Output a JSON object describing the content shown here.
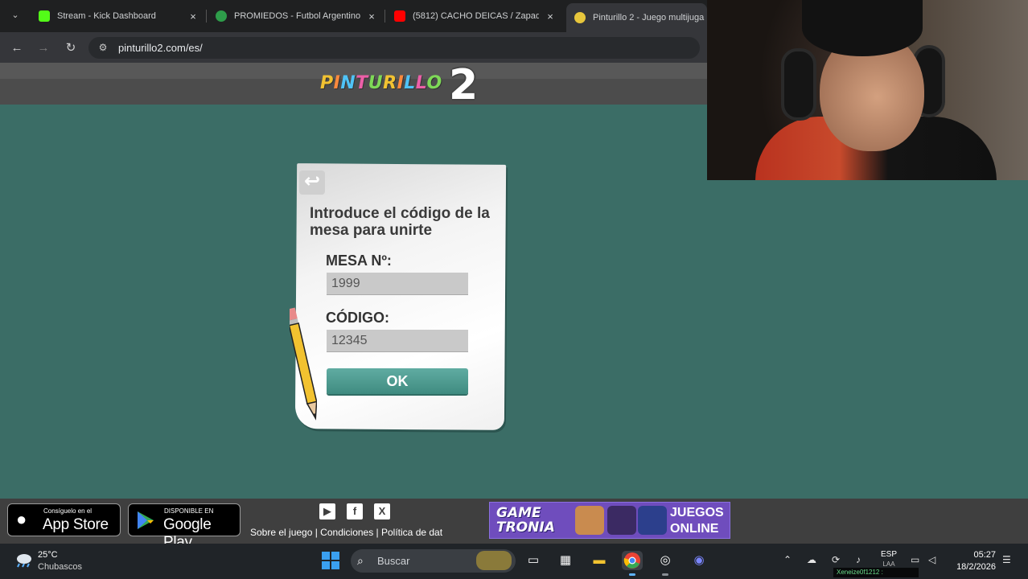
{
  "browser": {
    "tabs": [
      {
        "title": "Stream - Kick Dashboard",
        "icon": "kick-icon",
        "color": "#53fc18"
      },
      {
        "title": "PROMIEDOS - Futbol Argentino",
        "icon": "promiedos-icon",
        "color": "#2e9d4a"
      },
      {
        "title": "(5812) CACHO DEICAS / Zapad",
        "icon": "youtube-icon",
        "color": "#ff0000"
      },
      {
        "title": "Pinturillo 2 - Juego multijuga",
        "icon": "pinturillo-icon",
        "color": "#e7c63c"
      }
    ],
    "tab_close": "×",
    "address": "pinturillo2.com/es/"
  },
  "site": {
    "logo_text": "PINTURILLO",
    "logo_number": "2",
    "logo_colors": [
      "#f1c232",
      "#ff8a3d",
      "#4fc3f7",
      "#ec5fa8",
      "#7ed957"
    ]
  },
  "dialog": {
    "back_glyph": "↩",
    "title": "Introduce el código de la mesa para unirte",
    "table_label": "MESA Nº:",
    "table_value": "1999",
    "code_label": "CÓDIGO:",
    "code_value": "12345",
    "ok_label": "OK"
  },
  "footer": {
    "app_store": {
      "small": "Consíguelo en el",
      "big": "App Store"
    },
    "google_play": {
      "small": "DISPONIBLE EN",
      "big": "Google Play"
    },
    "social": [
      "youtube-icon",
      "facebook-icon",
      "x-icon"
    ],
    "links": "Sobre el juego | Condiciones | Política de dat",
    "ad": {
      "brand_line1": "GAME",
      "brand_line2": "TRONIA",
      "cta_line1": "JUEGOS",
      "cta_line2": "ONLINE"
    }
  },
  "taskbar": {
    "weather_temp": "25°C",
    "weather_desc": "Chubascos",
    "search_placeholder": "Buscar",
    "language": "ESP",
    "language_sub": "LAA",
    "time": "05:27",
    "date": "18/2/2026",
    "chat_overlay": "Xeneize0f1212 :"
  },
  "colors": {
    "page_background": "#3b6d66",
    "ok_button": "#4f9c91",
    "accent_blue": "#3aa0f0"
  }
}
